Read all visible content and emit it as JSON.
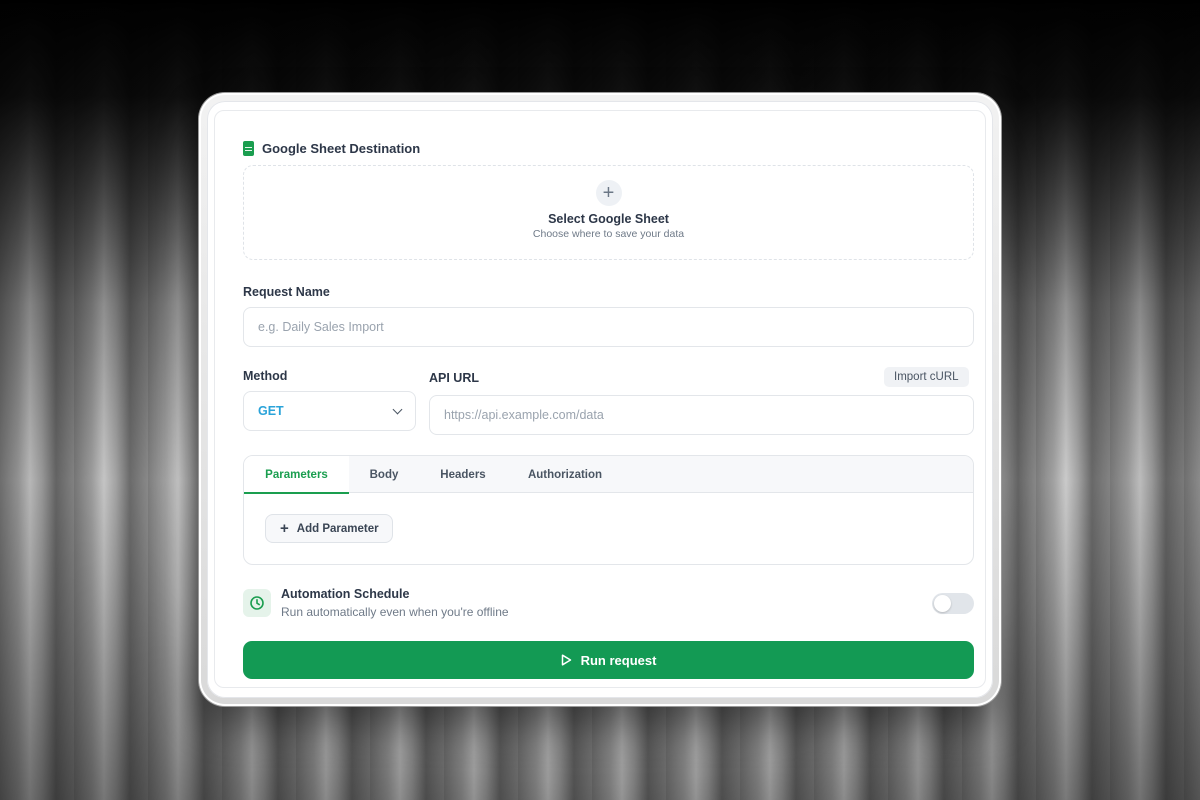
{
  "destination": {
    "title": "Google Sheet Destination",
    "select_title": "Select Google Sheet",
    "select_subtitle": "Choose where to save your data"
  },
  "request_name": {
    "label": "Request Name",
    "placeholder": "e.g. Daily Sales Import",
    "value": ""
  },
  "method": {
    "label": "Method",
    "selected": "GET"
  },
  "api_url": {
    "label": "API URL",
    "placeholder": "https://api.example.com/data",
    "value": "",
    "import_button": "Import cURL"
  },
  "tabs": {
    "items": [
      {
        "label": "Parameters",
        "active": true
      },
      {
        "label": "Body",
        "active": false
      },
      {
        "label": "Headers",
        "active": false
      },
      {
        "label": "Authorization",
        "active": false
      }
    ],
    "add_parameter_label": "Add Parameter"
  },
  "schedule": {
    "title": "Automation Schedule",
    "subtitle": "Run automatically even when you're offline",
    "enabled": false
  },
  "run_button": "Run request",
  "colors": {
    "accent_green": "#139a54",
    "method_blue": "#2aa3d9"
  },
  "icons": [
    "google-sheet-icon",
    "plus-icon",
    "chevron-down-icon",
    "clock-icon",
    "play-icon"
  ]
}
